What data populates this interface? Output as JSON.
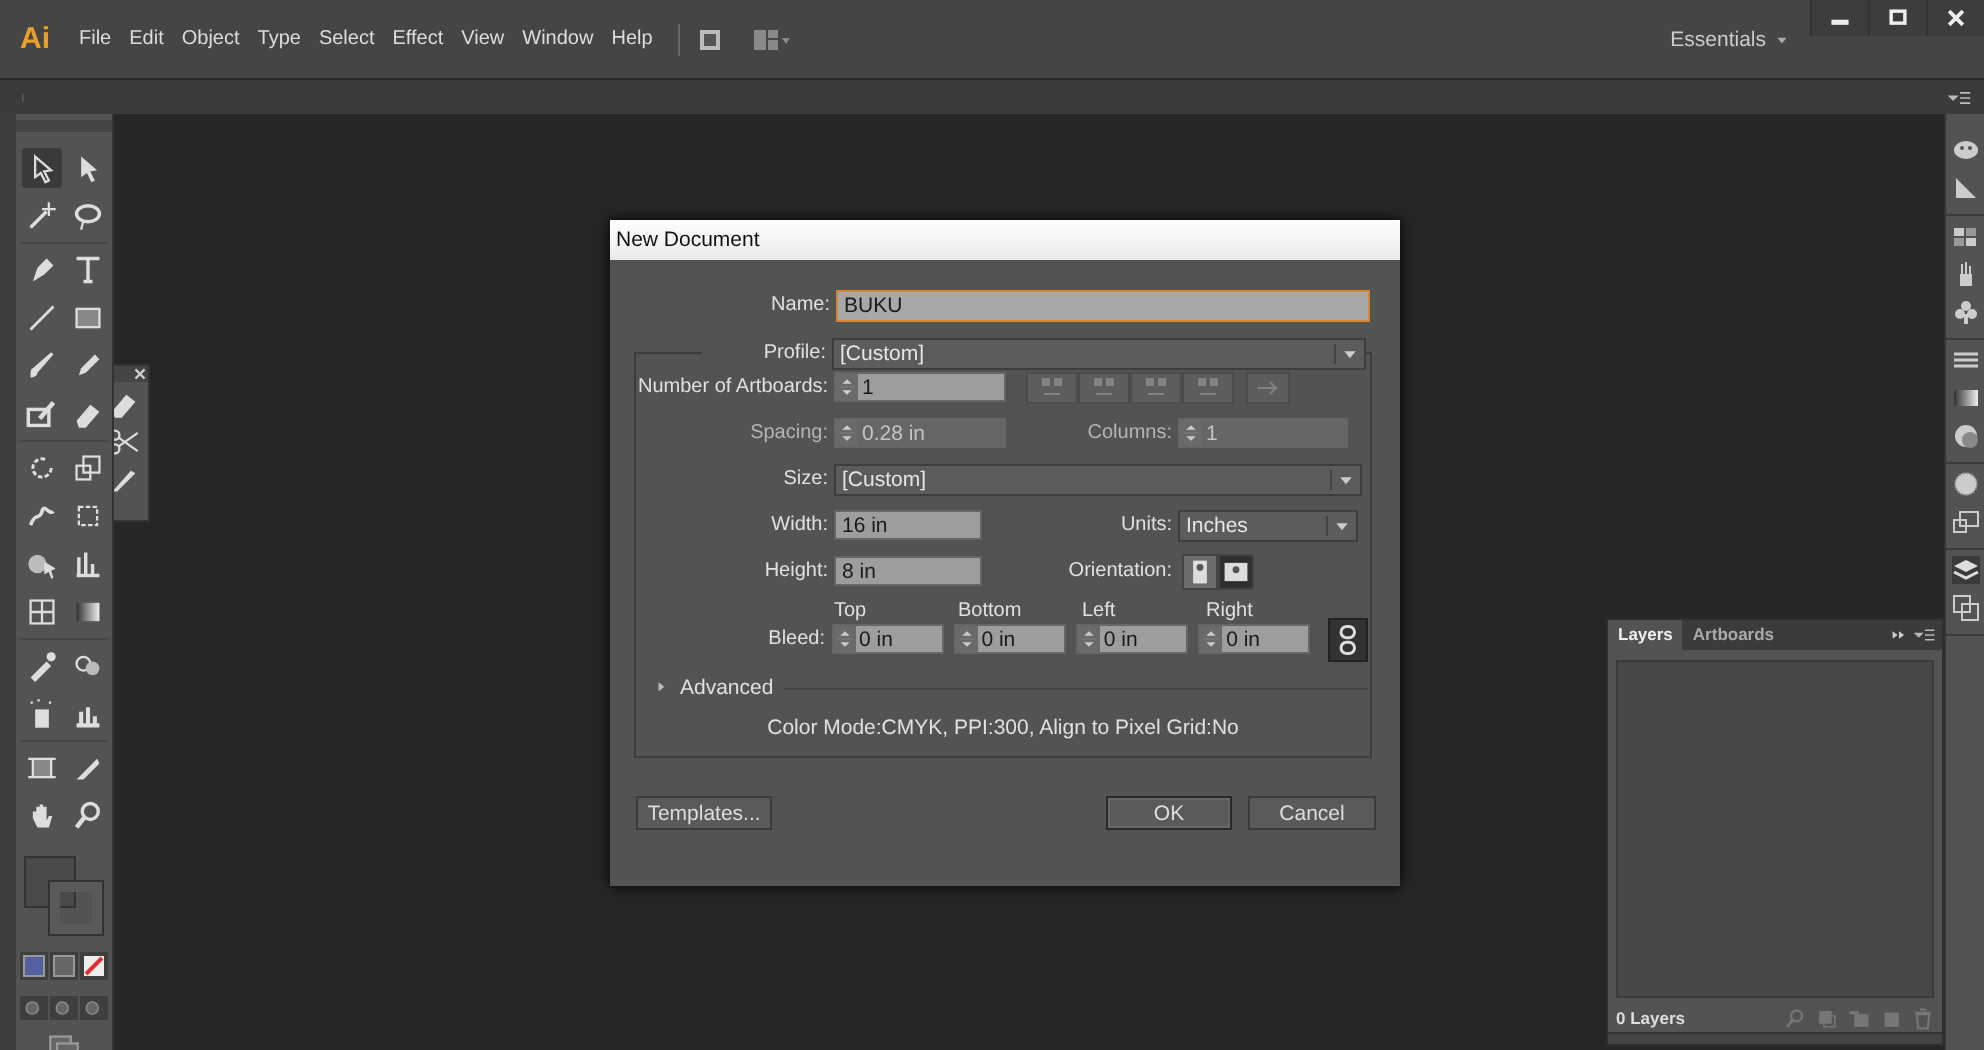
{
  "menubar": {
    "logo": "Ai",
    "menus": [
      {
        "label": "File"
      },
      {
        "label": "Edit"
      },
      {
        "label": "Object"
      },
      {
        "label": "Type"
      },
      {
        "label": "Select"
      },
      {
        "label": "Effect"
      },
      {
        "label": "View"
      },
      {
        "label": "Window"
      },
      {
        "label": "Help"
      }
    ],
    "workspace": "Essentials"
  },
  "dialog": {
    "title": "New Document",
    "name": {
      "label": "Name:",
      "value": "BUKU"
    },
    "profile": {
      "label": "Profile:",
      "value": "[Custom]"
    },
    "artboards": {
      "label": "Number of Artboards:",
      "value": "1"
    },
    "spacing": {
      "label": "Spacing:",
      "value": "0.28 in",
      "disabled": true
    },
    "columns": {
      "label": "Columns:",
      "value": "1",
      "disabled": true
    },
    "size": {
      "label": "Size:",
      "value": "[Custom]"
    },
    "width": {
      "label": "Width:",
      "value": "16 in"
    },
    "units": {
      "label": "Units:",
      "value": "Inches"
    },
    "height": {
      "label": "Height:",
      "value": "8 in"
    },
    "orientation": {
      "label": "Orientation:",
      "options": [
        {
          "kind": "portrait",
          "selected": false
        },
        {
          "kind": "landscape",
          "selected": true
        }
      ]
    },
    "bleed": {
      "label": "Bleed:",
      "sides": [
        {
          "heading": "Top",
          "value": "0 in"
        },
        {
          "heading": "Bottom",
          "value": "0 in"
        },
        {
          "heading": "Left",
          "value": "0 in"
        },
        {
          "heading": "Right",
          "value": "0 in"
        }
      ]
    },
    "advanced": {
      "label": "Advanced",
      "expanded": false
    },
    "info": "Color Mode:CMYK, PPI:300, Align to Pixel Grid:No",
    "buttons": [
      {
        "label": "Templates...",
        "default": false
      },
      {
        "label": "OK",
        "default": true
      },
      {
        "label": "Cancel",
        "default": false
      }
    ]
  },
  "layers_panel": {
    "tabs": [
      {
        "label": "Layers",
        "selected": true
      },
      {
        "label": "Artboards",
        "selected": false
      }
    ],
    "footer": "0 Layers"
  }
}
